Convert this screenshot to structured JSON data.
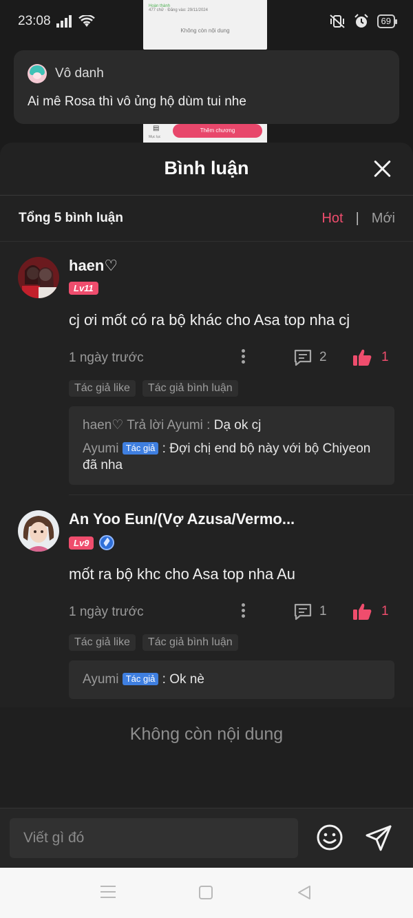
{
  "status_bar": {
    "time": "23:08",
    "battery": "69"
  },
  "background_page": {
    "line1": "Hoàn thành",
    "line2": "477 chữ · Đăng vào: 29/11/2024",
    "empty": "Không còn nội dung",
    "catalog_label": "Mục lục",
    "add_chapter_button": "Thêm chương"
  },
  "anon_comment": {
    "name": "Vô danh",
    "text": "Ai mê Rosa thì vô ủng hộ dùm tui nhe"
  },
  "sheet": {
    "title": "Bình luận",
    "total": "Tổng 5 bình luận",
    "sort_hot": "Hot",
    "sort_sep": "|",
    "sort_new": "Mới"
  },
  "comments": [
    {
      "name": "haen♡",
      "level": "Lv11",
      "text": "cj ơi mốt có ra bộ khác cho Asa top nha cj",
      "time": "1 ngày trước",
      "reply_count": "2",
      "like_count": "1",
      "tags": [
        "Tác giả like",
        "Tác giả bình luận"
      ],
      "replies": [
        {
          "prefix": "haen♡ Trả lời Ayumi : ",
          "badge": "",
          "message": "Dạ ok cj"
        },
        {
          "prefix": "Ayumi",
          "badge": "Tác giả",
          "message": "Đợi chị end bộ này với bộ Chiyeon đã nha"
        }
      ]
    },
    {
      "name": "An Yoo Eun/(Vợ Azusa/Vermo...",
      "level": "Lv9",
      "text": "mốt ra bộ khc cho Asa top nha Au",
      "time": "1 ngày trước",
      "reply_count": "1",
      "like_count": "1",
      "tags": [
        "Tác giả like",
        "Tác giả bình luận"
      ],
      "replies": [
        {
          "prefix": "Ayumi",
          "badge": "Tác giả",
          "message": "Ok nè"
        }
      ]
    }
  ],
  "end_text": "Không còn nội dung",
  "composer": {
    "placeholder": "Viết gì đó"
  },
  "colors": {
    "accent": "#ef4d6d",
    "author_badge": "#3f7fe0",
    "sheet_bg": "#222222"
  }
}
